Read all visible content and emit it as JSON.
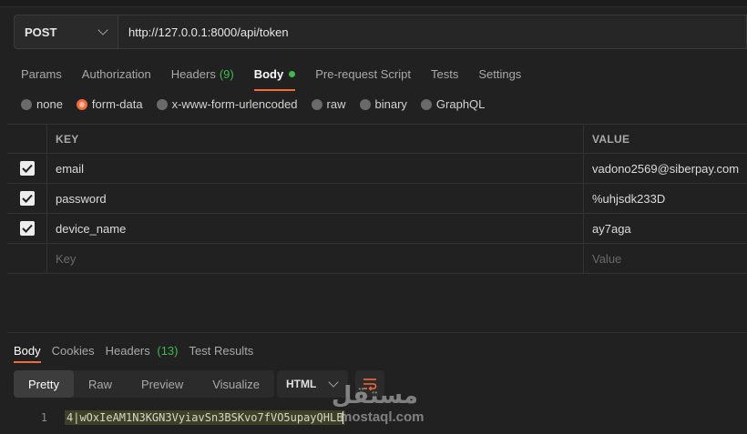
{
  "request": {
    "method": "POST",
    "url": "http://127.0.0.1:8000/api/token"
  },
  "request_tabs": [
    {
      "label": "Params"
    },
    {
      "label": "Authorization"
    },
    {
      "label": "Headers",
      "count": "(9)"
    },
    {
      "label": "Body",
      "active": true
    },
    {
      "label": "Pre-request Script"
    },
    {
      "label": "Tests"
    },
    {
      "label": "Settings"
    }
  ],
  "body_types": [
    {
      "label": "none"
    },
    {
      "label": "form-data",
      "selected": true
    },
    {
      "label": "x-www-form-urlencoded"
    },
    {
      "label": "raw"
    },
    {
      "label": "binary"
    },
    {
      "label": "GraphQL"
    }
  ],
  "table": {
    "key_header": "KEY",
    "value_header": "VALUE",
    "rows": [
      {
        "key": "email",
        "value": "vadono2569@siberpay.com",
        "checked": true
      },
      {
        "key": "password",
        "value": "%uhjsdk233D",
        "checked": true
      },
      {
        "key": "device_name",
        "value": "ay7aga",
        "checked": true
      }
    ],
    "new_row": {
      "key_placeholder": "Key",
      "value_placeholder": "Value"
    }
  },
  "response_tabs": [
    {
      "label": "Body",
      "active": true
    },
    {
      "label": "Cookies"
    },
    {
      "label": "Headers",
      "count": "(13)"
    },
    {
      "label": "Test Results"
    }
  ],
  "view_modes": [
    {
      "label": "Pretty",
      "active": true
    },
    {
      "label": "Raw"
    },
    {
      "label": "Preview"
    },
    {
      "label": "Visualize"
    }
  ],
  "format": "HTML",
  "response_body": {
    "line_number": "1",
    "content": "4|wOxIeAM1N3KGN3VyiavSn3BSKvo7fVO5upayQHLE"
  },
  "watermark": {
    "arabic": "مستقل",
    "latin": "mostaql.com"
  },
  "colors": {
    "accent": "#f26b3a",
    "success": "#3fb950",
    "background": "#212121"
  },
  "icons": {
    "method_dropdown": "chevron-down-icon",
    "format_dropdown": "chevron-down-icon",
    "wrap": "wrap-lines-icon",
    "checkbox": "check-icon"
  }
}
